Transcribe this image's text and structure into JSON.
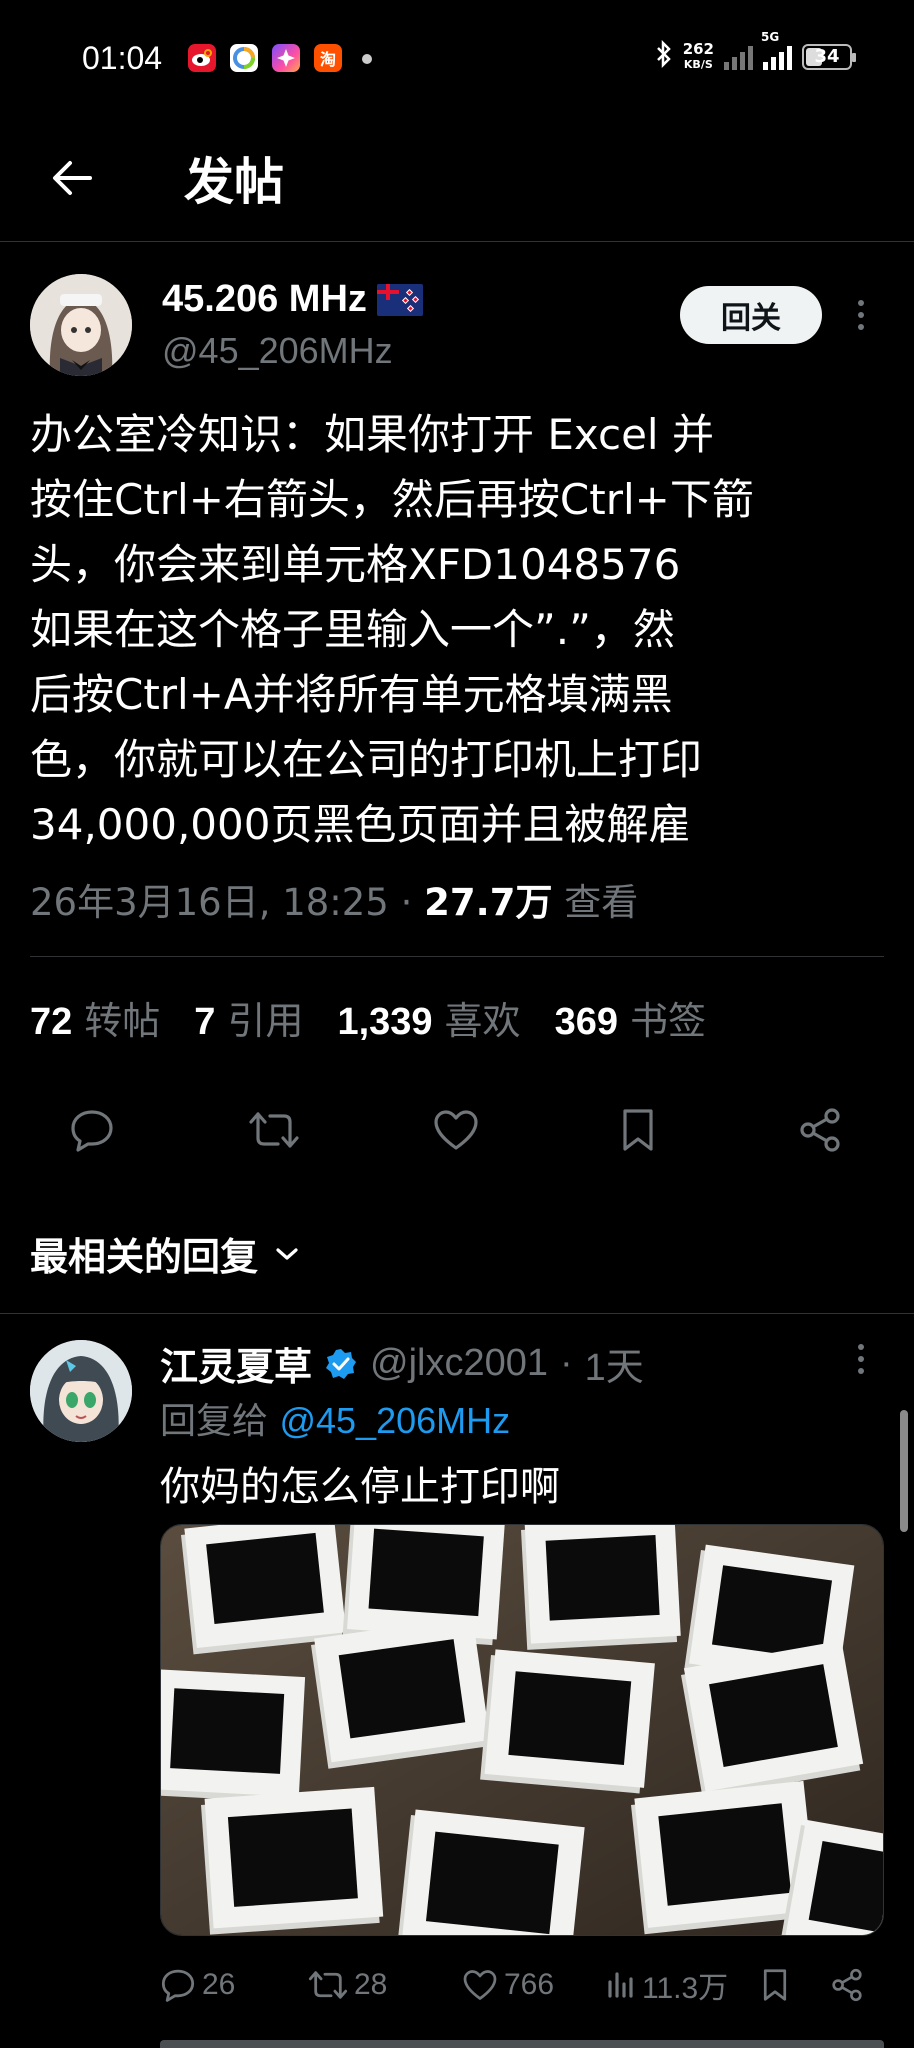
{
  "status_bar": {
    "time": "01:04",
    "net_speed_value": "262",
    "net_speed_unit": "KB/S",
    "network_type": "5G",
    "battery": "34",
    "icons": [
      "weibo-icon",
      "browser-icon",
      "star-app-icon",
      "taobao-icon",
      "notification-dot",
      "bluetooth-icon",
      "signal-icon",
      "battery-icon"
    ]
  },
  "header": {
    "title": "发帖",
    "back_icon": "arrow-left-icon"
  },
  "tweet": {
    "author_name": "45.206 MHz",
    "author_flag": "nz-flag-icon",
    "author_handle": "@45_206MHz",
    "follow_label": "回关",
    "text": "办公室冷知识：如果你打开 Excel 并\n按住Ctrl+右箭头，然后再按Ctrl+下箭\n头，你会来到单元格XFD1048576\n如果在这个格子里输入一个”.”，然\n后按Ctrl+A并将所有单元格填满黑\n色，你就可以在公司的打印机上打印\n34,000,000页黑色页面并且被解雇",
    "datetime": "26年3月16日, 18:25",
    "dot": "·",
    "views_count": "27.7万",
    "views_label": "查看",
    "stats": [
      {
        "count": "72",
        "label": "转帖"
      },
      {
        "count": "7",
        "label": "引用"
      },
      {
        "count": "1,339",
        "label": "喜欢"
      },
      {
        "count": "369",
        "label": "书签"
      }
    ]
  },
  "replies_sort": {
    "label": "最相关的回复"
  },
  "reply": {
    "author_name": "江灵夏草",
    "verified": true,
    "handle": "@jlxc2001",
    "dot": "·",
    "time": "1天",
    "reply_to_label": "回复给",
    "reply_to_handle": "@45_206MHz",
    "text": "你妈的怎么停止打印啊",
    "media_description": "photo",
    "actions": {
      "comments": "26",
      "retweets": "28",
      "likes": "766",
      "views": "11.3万"
    }
  },
  "colors": {
    "background": "#000000",
    "text_primary": "#e7e9ea",
    "text_secondary": "#71767b",
    "link": "#1d9bf0",
    "divider": "#2f3336",
    "follow_button_bg": "#eff3f4"
  }
}
